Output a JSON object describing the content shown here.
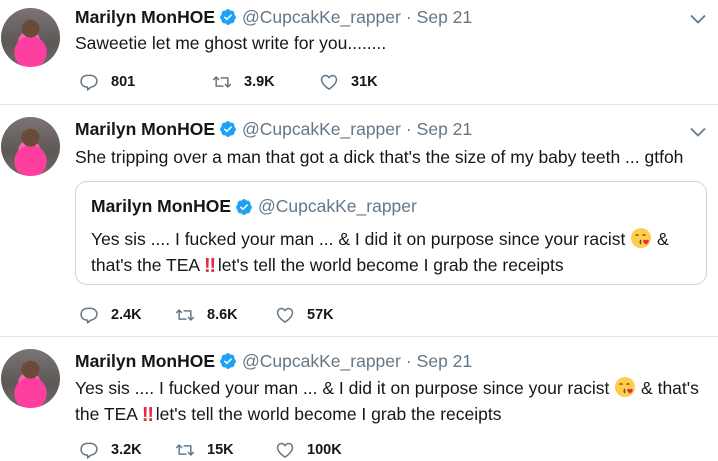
{
  "colors": {
    "verified": "#1da1f2",
    "secondary_text": "#657786",
    "border": "#e1e8ed",
    "icon": "#657786"
  },
  "tweets": [
    {
      "author_name": "Marilyn MonHOE",
      "handle": "@CupcakKe_rapper",
      "separator": "·",
      "date": "Sep 21",
      "text": "Saweetie let me ghost write for you........",
      "replies": "801",
      "retweets": "3.9K",
      "likes": "31K"
    },
    {
      "author_name": "Marilyn MonHOE",
      "handle": "@CupcakKe_rapper",
      "separator": "·",
      "date": "Sep 21",
      "text": "She tripping over a man that got a dick that's the size of my baby teeth ... gtfoh",
      "quote": {
        "author_name": "Marilyn MonHOE",
        "handle": "@CupcakKe_rapper",
        "text_part1": "Yes sis .... I fucked your man ... & I did it on purpose since your racist ",
        "text_part2": " & that's the TEA ",
        "text_part3": " let's tell the world become I grab the receipts"
      },
      "replies": "2.4K",
      "retweets": "8.6K",
      "likes": "57K"
    },
    {
      "author_name": "Marilyn MonHOE",
      "handle": "@CupcakKe_rapper",
      "separator": "·",
      "date": "Sep 21",
      "text_part1": "Yes sis .... I fucked your man ... & I did it on purpose since your racist ",
      "text_part2": " & that's the TEA ",
      "text_part3": " let's tell the world become I grab the receipts",
      "replies": "3.2K",
      "retweets": "15K",
      "likes": "100K"
    }
  ],
  "emoji": {
    "kiss": "face-blowing-kiss-emoji",
    "bang": "‼"
  }
}
